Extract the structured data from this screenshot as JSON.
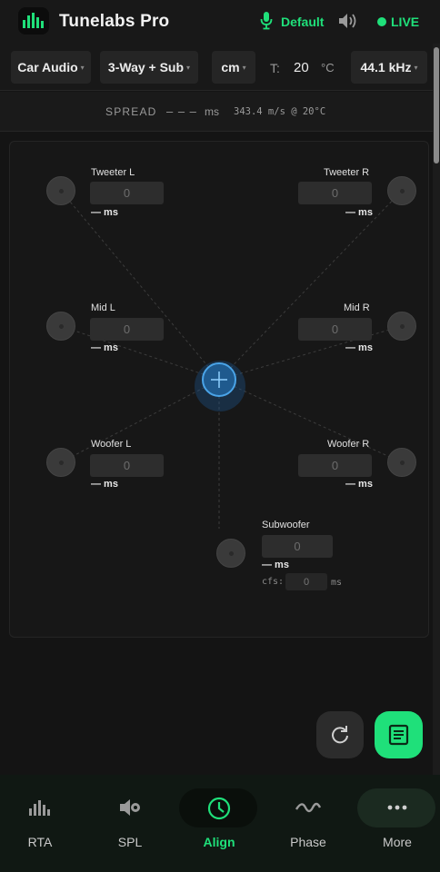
{
  "app": {
    "title": "Tunelabs Pro",
    "profile": "Default",
    "status": "LIVE"
  },
  "colors": {
    "accent": "#1fe07a",
    "center": "#1f5a8e"
  },
  "toolbar": {
    "mode": "Car Audio",
    "config": "3-Way + Sub",
    "unit": "cm",
    "temp_label": "T:",
    "temp_value": "20",
    "temp_unit": "°C",
    "sample_rate": "44.1 kHz"
  },
  "spread": {
    "label": "SPREAD",
    "value": "– – –",
    "unit": "ms",
    "sound_speed": "343.4 m/s @ 20°C"
  },
  "channels": [
    {
      "name": "Tweeter L",
      "placeholder": "0",
      "delay": "— ms"
    },
    {
      "name": "Tweeter R",
      "placeholder": "0",
      "delay": "— ms"
    },
    {
      "name": "Mid L",
      "placeholder": "0",
      "delay": "— ms"
    },
    {
      "name": "Mid R",
      "placeholder": "0",
      "delay": "— ms"
    },
    {
      "name": "Woofer L",
      "placeholder": "0",
      "delay": "— ms"
    },
    {
      "name": "Woofer R",
      "placeholder": "0",
      "delay": "— ms"
    },
    {
      "name": "Subwoofer",
      "placeholder": "0",
      "delay": "— ms"
    }
  ],
  "sub_offset": {
    "label": "cfs:",
    "placeholder": "0",
    "unit": "ms"
  },
  "nav": [
    {
      "label": "RTA",
      "icon": "bar-chart-icon"
    },
    {
      "label": "SPL",
      "icon": "speaker-meter-icon"
    },
    {
      "label": "Align",
      "icon": "clock-icon",
      "active": true
    },
    {
      "label": "Phase",
      "icon": "wave-icon"
    },
    {
      "label": "More",
      "icon": "more-dots-icon"
    }
  ]
}
